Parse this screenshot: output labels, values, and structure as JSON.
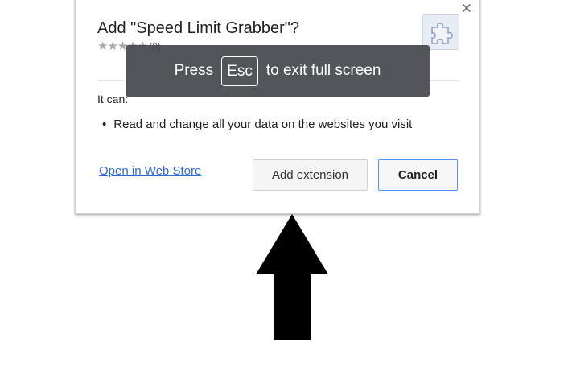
{
  "dialog": {
    "close_glyph": "×",
    "title": "Add \"Speed Limit Grabber\"?",
    "rating": {
      "stars_text": "★★★★★",
      "count": "(0)"
    },
    "extension_icon": "puzzle-piece-icon",
    "permissions_heading": "It can:",
    "permissions": [
      {
        "bullet": "•",
        "text": "Read and change all your data on the websites you visit"
      }
    ],
    "store_link": "Open in Web Store",
    "add_button": "Add extension",
    "cancel_button": "Cancel"
  },
  "fullscreen_toast": {
    "prefix": "Press",
    "key": "Esc",
    "suffix": "to exit full screen"
  },
  "annotation": {
    "arrow_icon": "up-arrow-icon",
    "color": "#000000"
  },
  "colors": {
    "link": "#3367d6",
    "cancel_border": "#4d90fe",
    "toast_bg": "#46484c"
  }
}
